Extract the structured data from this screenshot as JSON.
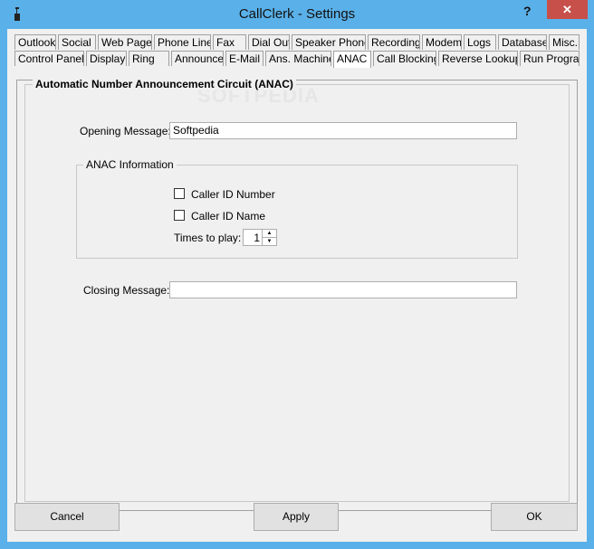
{
  "window": {
    "title": "CallClerk - Settings",
    "help_label": "?",
    "close_label": "✕"
  },
  "tabs": {
    "row1": [
      {
        "label": "Outlook"
      },
      {
        "label": "Social"
      },
      {
        "label": "Web Page"
      },
      {
        "label": "Phone Line"
      },
      {
        "label": "Fax"
      },
      {
        "label": "Dial Out"
      },
      {
        "label": "Speaker Phone"
      },
      {
        "label": "Recording"
      },
      {
        "label": "Modem"
      },
      {
        "label": "Logs"
      },
      {
        "label": "Database"
      },
      {
        "label": "Misc."
      }
    ],
    "row2": [
      {
        "label": "Control Panel"
      },
      {
        "label": "Display"
      },
      {
        "label": "Ring"
      },
      {
        "label": "Announce"
      },
      {
        "label": "E-Mail"
      },
      {
        "label": "Ans. Machine"
      },
      {
        "label": "ANAC"
      },
      {
        "label": "Call Blocking"
      },
      {
        "label": "Reverse Lookup"
      },
      {
        "label": "Run Program"
      }
    ],
    "active": "ANAC"
  },
  "anac": {
    "section_title": "Automatic Number Announcement Circuit (ANAC)",
    "watermark": "SOFTPEDIA",
    "opening_label": "Opening Message:",
    "opening_value": "Softpedia",
    "info_group": "ANAC Information",
    "caller_id_number_label": "Caller ID Number",
    "caller_id_number_checked": false,
    "caller_id_name_label": "Caller ID Name",
    "caller_id_name_checked": false,
    "times_label": "Times to play:",
    "times_value": "1",
    "closing_label": "Closing Message:",
    "closing_value": ""
  },
  "buttons": {
    "cancel": "Cancel",
    "apply": "Apply",
    "ok": "OK"
  }
}
